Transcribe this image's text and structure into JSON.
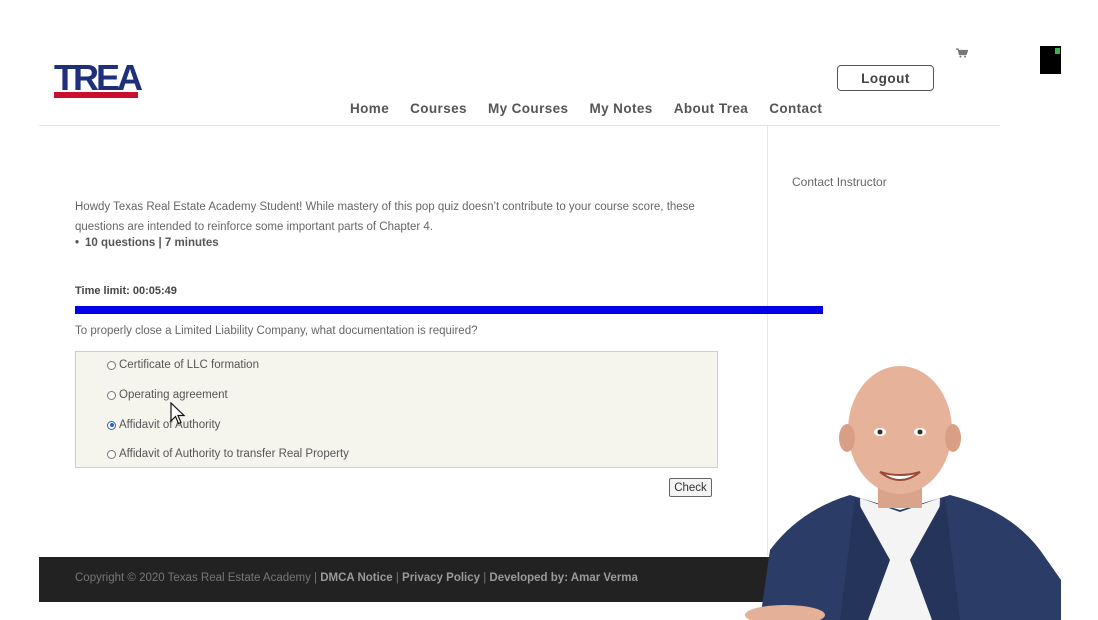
{
  "logo": {
    "text": "TREA"
  },
  "nav": {
    "items": [
      "Home",
      "Courses",
      "My Courses",
      "My Notes",
      "About Trea",
      "Contact"
    ]
  },
  "header": {
    "logout_label": "Logout"
  },
  "sidebar": {
    "contact_instructor": "Contact Instructor"
  },
  "quiz": {
    "intro": "Howdy Texas Real Estate Academy Student! While mastery of this pop quiz doesn’t contribute to your course score, these questions are intended to reinforce some important parts of Chapter 4.",
    "meta": "10 questions | 7 minutes",
    "time_limit": "Time limit: 00:05:49",
    "progress": 1.0,
    "question": "To properly close a Limited Liability Company, what documentation is required?",
    "answers": [
      {
        "label": "Certificate of LLC formation",
        "checked": false
      },
      {
        "label": "Operating agreement",
        "checked": false
      },
      {
        "label": "Affidavit of Authority",
        "checked": true
      },
      {
        "label": "Affidavit of Authority to transfer Real Property",
        "checked": false
      }
    ],
    "check_label": "Check"
  },
  "footer": {
    "copyright": "Copyright © 2020 Texas Real Estate Academy | ",
    "dmca": "DMCA Notice",
    "sep1": " | ",
    "privacy": "Privacy Policy",
    "sep2": " | ",
    "developed": "Developed by: Amar Verma"
  },
  "colors": {
    "brand_blue": "#1f2f7a",
    "brand_red": "#c8102e",
    "progress": "#0000e6",
    "footer_bg": "#222222",
    "selected_radio": "#2a62c8"
  },
  "icons": [
    "cart-icon",
    "mouse-cursor-icon"
  ]
}
